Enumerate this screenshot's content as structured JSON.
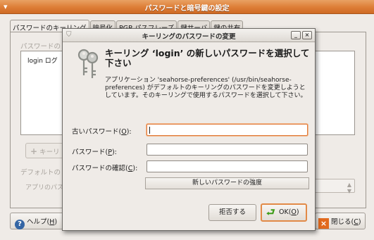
{
  "main_window": {
    "title": "パスワードと暗号鍵の設定",
    "tabs": [
      {
        "label": "パスワードのキーリング",
        "active": true
      },
      {
        "label": "暗号化",
        "active": false
      },
      {
        "label": "PGP パスフレーズ",
        "active": false
      },
      {
        "label": "鍵サーバ",
        "active": false
      },
      {
        "label": "鍵の共有",
        "active": false
      }
    ],
    "section_label": "パスワードの",
    "keyring_list": [
      {
        "label": "login ログ"
      }
    ],
    "add_button": "キーリ",
    "default_label": "デフォルトの",
    "app_label": "アプリのパス",
    "help_button": {
      "text": "ヘルプ(",
      "mnemonic": "H",
      "suffix": ")"
    },
    "close_button": {
      "text": "閉じる(",
      "mnemonic": "C",
      "suffix": ")"
    }
  },
  "dialog": {
    "title": "キーリングのパスワードの変更",
    "heading": "キーリング ‘login’ の新しいパスワードを選択して下さい",
    "description": "アプリケーション 'seahorse-preferences' (/usr/bin/seahorse-preferences) がデフォルトのキーリングのパスワードを変更しようとしています。そのキーリングで使用するパスワードを選択して下さい。",
    "fields": [
      {
        "label": "古いパスワード(",
        "mnemonic": "O",
        "suffix": "):",
        "value": "",
        "focused": true
      },
      {
        "label": "パスワード(",
        "mnemonic": "P",
        "suffix": "):",
        "value": "",
        "focused": false
      },
      {
        "label": "パスワードの確認(",
        "mnemonic": "C",
        "suffix": "):",
        "value": "",
        "focused": false
      }
    ],
    "strength_label": "新しいパスワードの強度",
    "reject_button": "拒否する",
    "ok_button": {
      "text": "OK(",
      "mnemonic": "O",
      "suffix": ")"
    },
    "minimize_glyph": "_",
    "close_glyph": "×"
  },
  "colors": {
    "accent": "#dd7d36",
    "ok_icon": "#3f9c19",
    "help_icon": "#3465a4"
  },
  "icons": [
    "window-menu-icon",
    "shield-icon",
    "keys-icon",
    "add-icon",
    "help-icon",
    "close-icon",
    "ok-check-icon",
    "spinner-arrows-icon"
  ]
}
